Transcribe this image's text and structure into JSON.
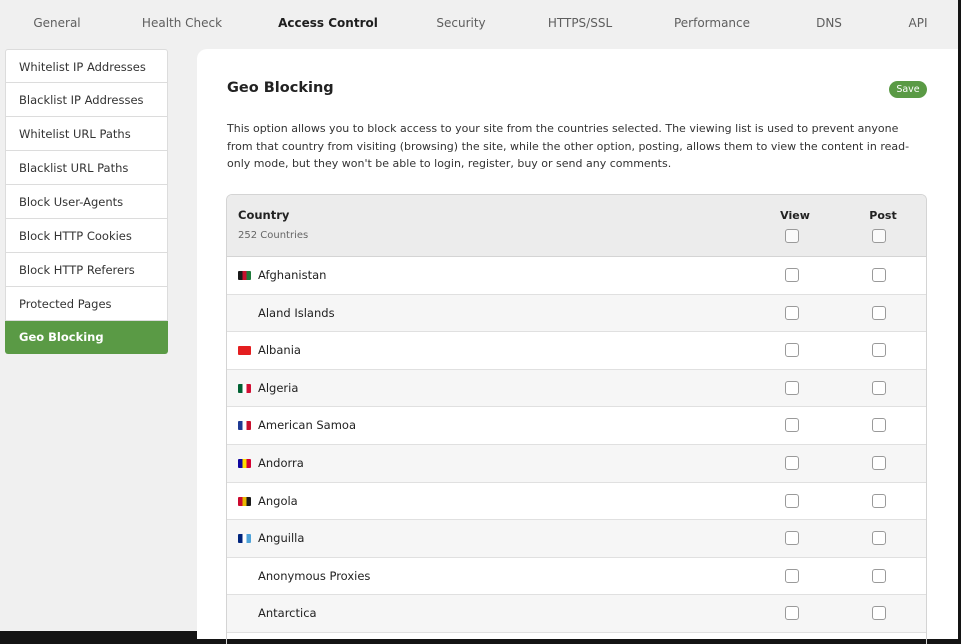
{
  "nav": {
    "tabs": [
      "General",
      "Health Check",
      "Access Control",
      "Security",
      "HTTPS/SSL",
      "Performance",
      "DNS",
      "API"
    ],
    "active_tab": "Access Control"
  },
  "sidebar": {
    "items": [
      {
        "label": "Whitelist IP Addresses"
      },
      {
        "label": "Blacklist IP Addresses"
      },
      {
        "label": "Whitelist URL Paths"
      },
      {
        "label": "Blacklist URL Paths"
      },
      {
        "label": "Block User-Agents"
      },
      {
        "label": "Block HTTP Cookies"
      },
      {
        "label": "Block HTTP Referers"
      },
      {
        "label": "Protected Pages"
      },
      {
        "label": "Geo Blocking"
      }
    ],
    "active_item": "Geo Blocking"
  },
  "main": {
    "title": "Geo Blocking",
    "save_label": "Save",
    "description": "This option allows you to block access to your site from the countries selected. The viewing list is used to prevent anyone from that country from visiting (browsing) the site, while the other option, posting, allows them to view the content in read-only mode, but they won't be able to login, register, buy or send any comments.",
    "table": {
      "country_header": "Country",
      "count_label": "252 Countries",
      "view_header": "View",
      "post_header": "Post",
      "rows": [
        {
          "name": "Afghanistan",
          "flag": [
            "#1a1a1a",
            "#c8102e",
            "#1f7a3a"
          ],
          "view": false,
          "post": false
        },
        {
          "name": "Aland Islands",
          "flag": null,
          "view": false,
          "post": false
        },
        {
          "name": "Albania",
          "flag": [
            "#e41e20",
            "#e41e20",
            "#e41e20"
          ],
          "view": false,
          "post": false
        },
        {
          "name": "Algeria",
          "flag": [
            "#006233",
            "#ffffff",
            "#d21034"
          ],
          "view": false,
          "post": false
        },
        {
          "name": "American Samoa",
          "flag": [
            "#1f3a93",
            "#ffffff",
            "#c8102e"
          ],
          "view": false,
          "post": false
        },
        {
          "name": "Andorra",
          "flag": [
            "#10069f",
            "#fedd00",
            "#d50032"
          ],
          "view": false,
          "post": false
        },
        {
          "name": "Angola",
          "flag": [
            "#cc092f",
            "#e8b800",
            "#1a1a1a"
          ],
          "view": false,
          "post": false
        },
        {
          "name": "Anguilla",
          "flag": [
            "#00247d",
            "#ffffff",
            "#4fa3d9"
          ],
          "view": false,
          "post": false
        },
        {
          "name": "Anonymous Proxies",
          "flag": null,
          "view": false,
          "post": false
        },
        {
          "name": "Antarctica",
          "flag": null,
          "view": false,
          "post": false
        }
      ]
    }
  },
  "colors": {
    "accent": "#5a9a45",
    "background": "#f0f0f0",
    "panel": "#ffffff"
  }
}
